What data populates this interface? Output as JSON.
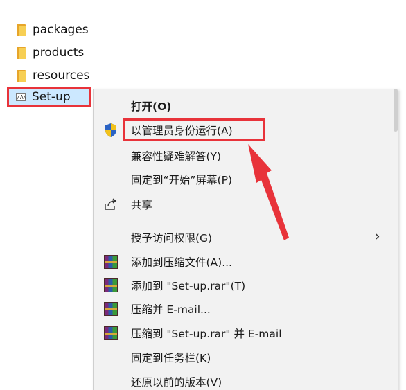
{
  "files": [
    {
      "name": "packages",
      "icon": "folder-icon"
    },
    {
      "name": "products",
      "icon": "folder-icon"
    },
    {
      "name": "resources",
      "icon": "folder-icon"
    }
  ],
  "selected_file": {
    "name": "Set-up",
    "icon": "setup-exe-icon"
  },
  "context_menu": {
    "items": [
      {
        "label": "打开(O)",
        "bold": true
      },
      {
        "label": "以管理员身份运行(A)",
        "icon": "uac-shield-icon"
      },
      {
        "label": "兼容性疑难解答(Y)"
      },
      {
        "label": "固定到“开始”屏幕(P)"
      },
      {
        "label": "共享",
        "icon": "share-icon"
      },
      {
        "label": "授予访问权限(G)",
        "submenu": true
      },
      {
        "label": "添加到压缩文件(A)...",
        "icon": "winrar-icon"
      },
      {
        "label": "添加到 \"Set-up.rar\"(T)",
        "icon": "winrar-icon"
      },
      {
        "label": "压缩并 E-mail...",
        "icon": "winrar-icon"
      },
      {
        "label": "压缩到 \"Set-up.rar\" 并 E-mail",
        "icon": "winrar-icon"
      },
      {
        "label": "固定到任务栏(K)"
      },
      {
        "label": "还原以前的版本(V)"
      }
    ]
  },
  "colors": {
    "highlight_red": "#e8333a",
    "selection_blue": "#cce8ff",
    "menu_bg": "#f2f2f2"
  }
}
